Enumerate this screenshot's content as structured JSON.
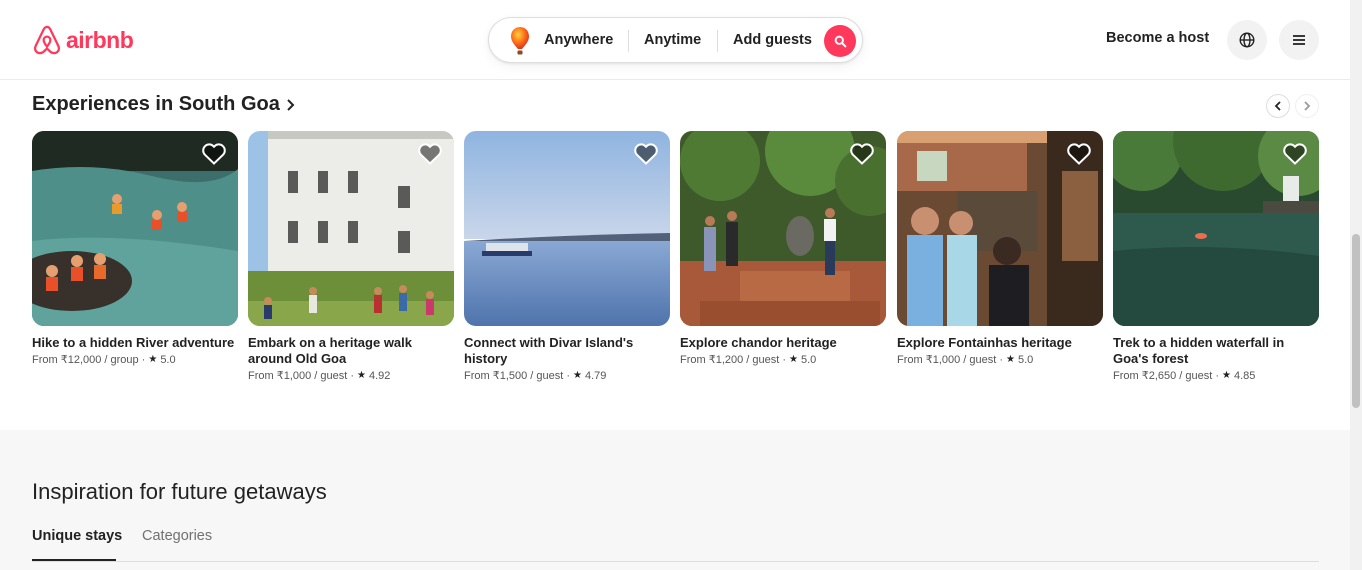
{
  "header": {
    "brand": "airbnb",
    "search": {
      "where": "Anywhere",
      "when": "Anytime",
      "who": "Add guests"
    },
    "become_host": "Become a host"
  },
  "experiences": {
    "title": "Experiences in South Goa",
    "cards": [
      {
        "title": "Hike to a hidden River adventure",
        "price": "From ₹12,000 / group",
        "rating": "5.0"
      },
      {
        "title": "Embark on a heritage walk around Old Goa",
        "price": "From ₹1,000 / guest",
        "rating": "4.92"
      },
      {
        "title": "Connect with Divar Island's history",
        "price": "From ₹1,500 / guest",
        "rating": "4.79"
      },
      {
        "title": "Explore chandor heritage",
        "price": "From ₹1,200 / guest",
        "rating": "5.0"
      },
      {
        "title": "Explore Fontainhas heritage",
        "price": "From ₹1,000 / guest",
        "rating": "5.0"
      },
      {
        "title": "Trek to a hidden waterfall in Goa's forest",
        "price": "From ₹2,650 / guest",
        "rating": "4.85"
      }
    ]
  },
  "inspiration": {
    "title": "Inspiration for future getaways",
    "tabs": [
      "Unique stays",
      "Categories"
    ]
  },
  "colors": {
    "brand": "#ff385c",
    "text": "#222222",
    "muted": "#717171"
  }
}
